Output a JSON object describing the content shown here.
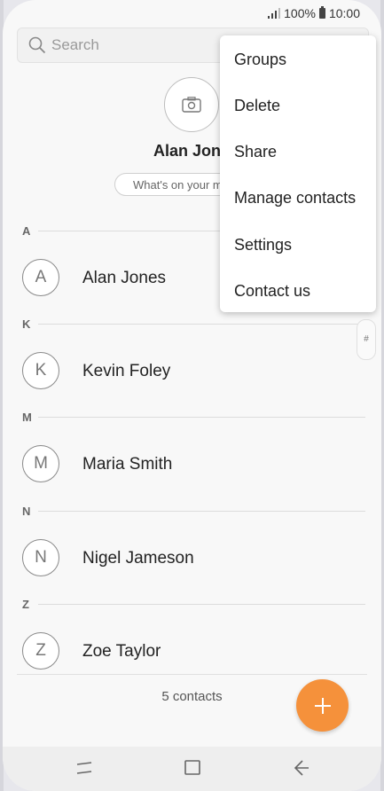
{
  "status": {
    "signal": "signal-icon",
    "battery_pct": "100%",
    "time": "10:00"
  },
  "search": {
    "placeholder": "Search"
  },
  "profile": {
    "name": "Alan Jones",
    "status_placeholder": "What's on your mind?"
  },
  "sections": [
    {
      "letter": "A",
      "contact": {
        "initial": "A",
        "name": "Alan Jones"
      }
    },
    {
      "letter": "K",
      "contact": {
        "initial": "K",
        "name": "Kevin Foley"
      }
    },
    {
      "letter": "M",
      "contact": {
        "initial": "M",
        "name": "Maria Smith"
      }
    },
    {
      "letter": "N",
      "contact": {
        "initial": "N",
        "name": "Nigel Jameson"
      }
    },
    {
      "letter": "Z",
      "contact": {
        "initial": "Z",
        "name": "Zoe Taylor"
      }
    }
  ],
  "index_strip": {
    "label": "#"
  },
  "footer": {
    "count": "5 contacts",
    "fab_icon": "plus-icon",
    "fab_color": "#f5913b"
  },
  "menu": {
    "items": [
      "Groups",
      "Delete",
      "Share",
      "Manage contacts",
      "Settings",
      "Contact us"
    ]
  },
  "navbar": {
    "icons": [
      "recent-apps-icon",
      "home-icon",
      "back-icon"
    ]
  }
}
